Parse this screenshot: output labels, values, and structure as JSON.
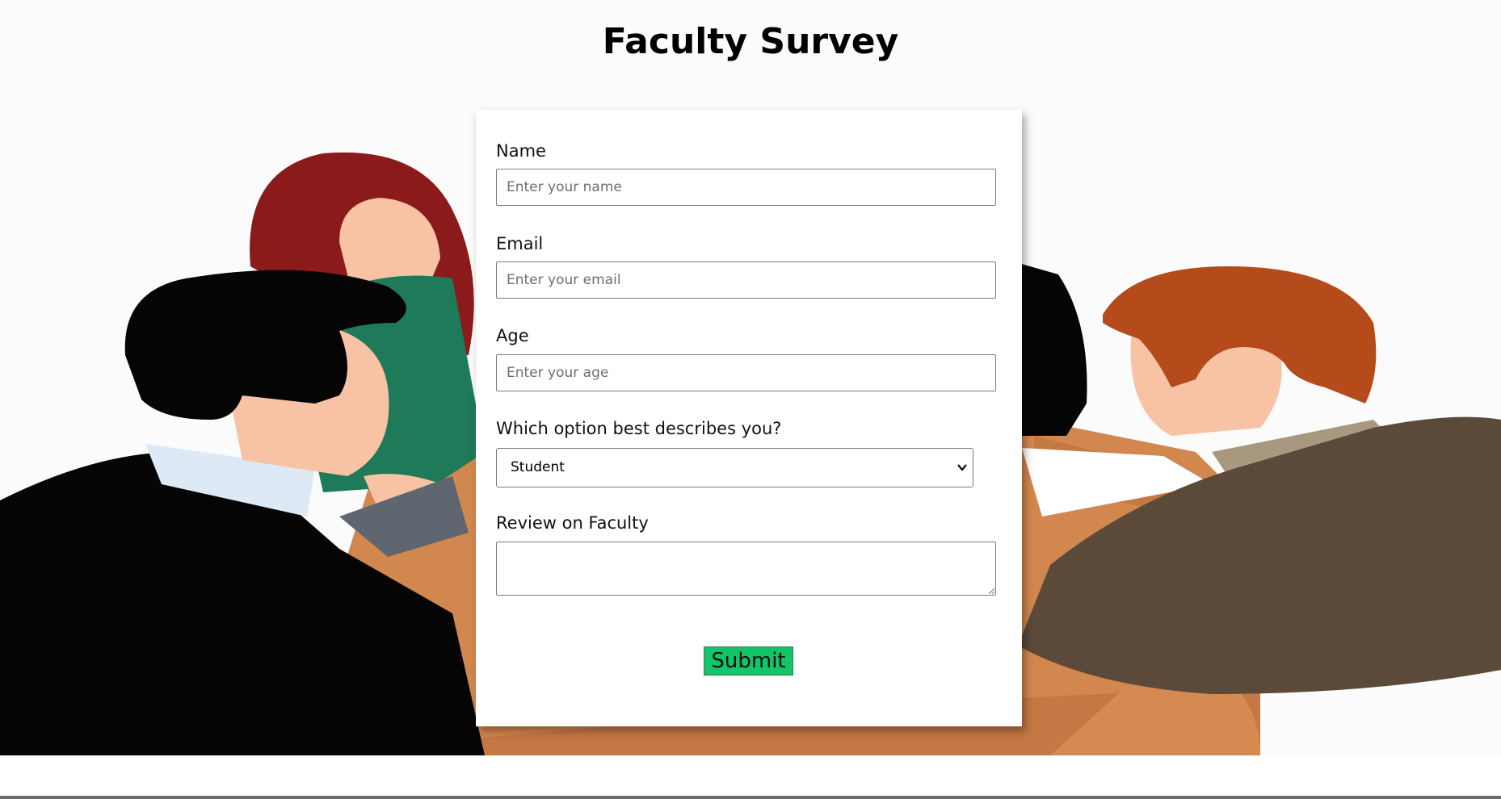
{
  "page": {
    "title": "Faculty Survey"
  },
  "form": {
    "name": {
      "label": "Name",
      "placeholder": "Enter your name"
    },
    "email": {
      "label": "Email",
      "placeholder": "Enter your email"
    },
    "age": {
      "label": "Age",
      "placeholder": "Enter your age"
    },
    "role": {
      "label": "Which option best describes you?",
      "selected": "Student"
    },
    "review": {
      "label": "Review on Faculty",
      "value": ""
    },
    "submit_label": "Submit"
  },
  "colors": {
    "submit_bg": "#12c46a",
    "accent_brown": "#d2874e",
    "hair_red": "#8b1a1a",
    "shirt_green": "#1f7a5a"
  },
  "icons": [
    "chevron-down-icon",
    "resize-handle-icon"
  ]
}
